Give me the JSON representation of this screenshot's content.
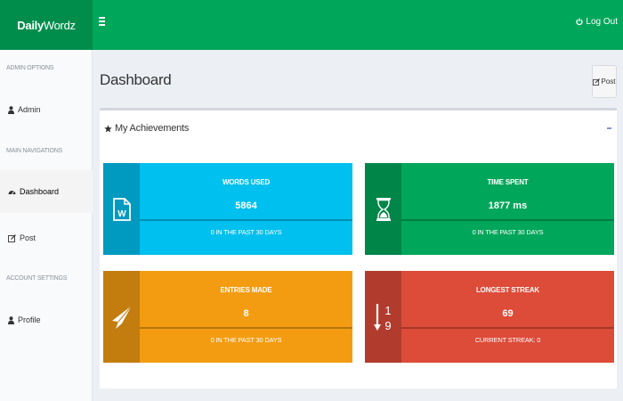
{
  "header": {
    "brand_bold": "Daily",
    "brand_rest": "Wordz",
    "logout_label": "Log Out"
  },
  "sidebar": {
    "admin_options_header": "ADMIN OPTIONS",
    "admin_label": "Admin",
    "main_nav_header": "MAIN NAVIGATIONS",
    "dashboard_label": "Dashboard",
    "post_label": "Post",
    "account_settings_header": "ACCOUNT SETTINGS",
    "profile_label": "Profile"
  },
  "main": {
    "title": "Dashboard",
    "post_button_label": "Post",
    "achievements_title": "My Achievements"
  },
  "cards": [
    {
      "label": "WORDS USED",
      "value": "5864",
      "sub": "0 IN THE PAST 30 DAYS",
      "color": "#00c0ef",
      "icon_color": "#0099bf",
      "icon": "word-document-icon",
      "progress": 1.0
    },
    {
      "label": "TIME SPENT",
      "value": "1877 ms",
      "sub": "0 IN THE PAST 30 DAYS",
      "color": "#00a65a",
      "icon_color": "#008548",
      "icon": "hourglass-icon",
      "progress": 1.0
    },
    {
      "label": "ENTRIES MADE",
      "value": "8",
      "sub": "0 IN THE PAST 30 DAYS",
      "color": "#f39c12",
      "icon_color": "#c27d0e",
      "icon": "paper-plane-icon",
      "progress": 1.0
    },
    {
      "label": "LONGEST STREAK",
      "value": "69",
      "sub": "CURRENT STREAK: 0",
      "color": "#dd4b39",
      "icon_color": "#b13c2e",
      "icon": "sort-numeric-icon",
      "progress": 1.0
    }
  ]
}
